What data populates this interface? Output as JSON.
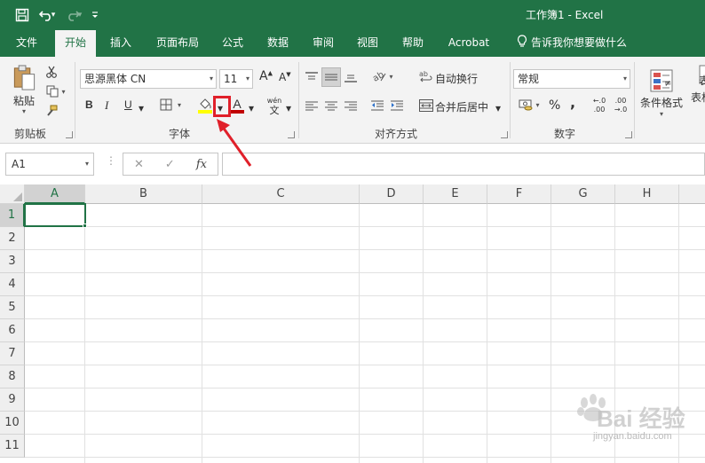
{
  "window": {
    "title": "工作簿1  -  Excel"
  },
  "qat": {
    "save_icon": "save-icon",
    "undo_icon": "undo-icon",
    "redo_icon": "redo-icon",
    "customize_icon": "customize-qat-icon"
  },
  "tabs": [
    {
      "label": "文件",
      "active": false
    },
    {
      "label": "开始",
      "active": true
    },
    {
      "label": "插入",
      "active": false
    },
    {
      "label": "页面布局",
      "active": false
    },
    {
      "label": "公式",
      "active": false
    },
    {
      "label": "数据",
      "active": false
    },
    {
      "label": "审阅",
      "active": false
    },
    {
      "label": "视图",
      "active": false
    },
    {
      "label": "帮助",
      "active": false
    },
    {
      "label": "Acrobat",
      "active": false
    }
  ],
  "tell_me": {
    "label": "告诉我你想要做什么",
    "icon": "lightbulb-icon"
  },
  "clipboard": {
    "paste_label": "粘贴",
    "group_label": "剪贴板"
  },
  "font": {
    "font_name": "思源黑体 CN",
    "font_size": "11",
    "bold": "B",
    "italic": "I",
    "underline": "U",
    "grow": "A",
    "shrink": "A",
    "font_color_glyph": "A",
    "phonetic_top": "wén",
    "phonetic_bottom": "文",
    "group_label": "字体",
    "fill_color": "#ffff00",
    "font_color": "#c00000"
  },
  "alignment": {
    "wrap_text": "自动换行",
    "merge_center": "合并后居中",
    "group_label": "对齐方式"
  },
  "number": {
    "format": "常规",
    "percent": "%",
    "comma": ",",
    "inc_decimal_top": "←.0",
    "inc_decimal_bottom": ".00",
    "dec_decimal_top": ".00",
    "dec_decimal_bottom": "→.0",
    "group_label": "数字"
  },
  "styles": {
    "conditional_format": "条件格式",
    "table_format_line1": "表",
    "table_format_line2": "表格"
  },
  "formula_bar": {
    "name_box": "A1",
    "cancel": "✕",
    "enter": "✓",
    "fx": "fx",
    "value": ""
  },
  "sheet": {
    "columns": [
      "A",
      "B",
      "C",
      "D",
      "E",
      "F",
      "G",
      "H"
    ],
    "rows": [
      "1",
      "2",
      "3",
      "4",
      "5",
      "6",
      "7",
      "8",
      "9",
      "10",
      "11"
    ],
    "active_cell": "A1"
  },
  "watermark": {
    "text": "Bai 经验",
    "sub": "jingyan.baidu.com"
  },
  "colors": {
    "excel_green": "#217346",
    "annotation_red": "#e0202a"
  }
}
